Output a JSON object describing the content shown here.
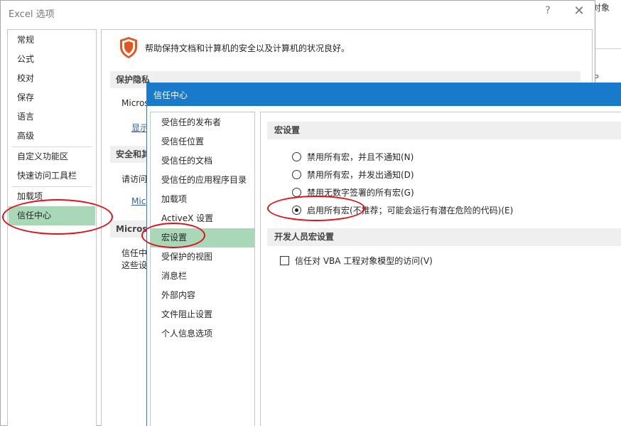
{
  "background": {
    "right_text": "对象",
    "right_small": "P"
  },
  "options_window": {
    "title": "Excel 选项",
    "help": "?",
    "close": "✕",
    "nav": [
      {
        "label": "常规"
      },
      {
        "label": "公式"
      },
      {
        "label": "校对"
      },
      {
        "label": "保存"
      },
      {
        "label": "语言"
      },
      {
        "label": "高级"
      },
      {
        "label": "自定义功能区"
      },
      {
        "label": "快速访问工具栏"
      },
      {
        "label": "加载项"
      },
      {
        "label": "信任中心",
        "active": true
      }
    ],
    "content": {
      "intro": "帮助保持文档和计算机的安全以及计算机的状况良好。",
      "section1": "保护隐私",
      "sec1_text": "Micros",
      "sec1_link": "显示",
      "section2": "安全和其",
      "sec2_text": "请访问",
      "sec2_link": "Mic",
      "section3": "Micros",
      "sec3_line1": "信任中",
      "sec3_line2": "这些设"
    }
  },
  "trust_center": {
    "title": "信任中心",
    "nav": [
      {
        "label": "受信任的发布者"
      },
      {
        "label": "受信任位置"
      },
      {
        "label": "受信任的文档"
      },
      {
        "label": "受信任的应用程序目录"
      },
      {
        "label": "加载项"
      },
      {
        "label": "ActiveX 设置"
      },
      {
        "label": "宏设置",
        "active": true
      },
      {
        "label": "受保护的视图"
      },
      {
        "label": "消息栏"
      },
      {
        "label": "外部内容"
      },
      {
        "label": "文件阻止设置"
      },
      {
        "label": "个人信息选项"
      }
    ],
    "macro_section": "宏设置",
    "macro_options": [
      {
        "label": "禁用所有宏，并且不通知(N)",
        "checked": false
      },
      {
        "label": "禁用所有宏，并发出通知(D)",
        "checked": false
      },
      {
        "label": "禁用无数字签署的所有宏(G)",
        "checked": false
      },
      {
        "label": "启用所有宏(不推荐；可能会运行有潜在危险的代码)(E)",
        "checked": true
      }
    ],
    "dev_section": "开发人员宏设置",
    "vba_checkbox": {
      "label": "信任对 VBA 工程对象模型的访问(V)",
      "checked": false
    }
  },
  "colors": {
    "accent_blue": "#1979ca",
    "selected_green": "#a9d8b8",
    "annotation_red": "#e0101a",
    "shield_orange": "#e8541e"
  }
}
